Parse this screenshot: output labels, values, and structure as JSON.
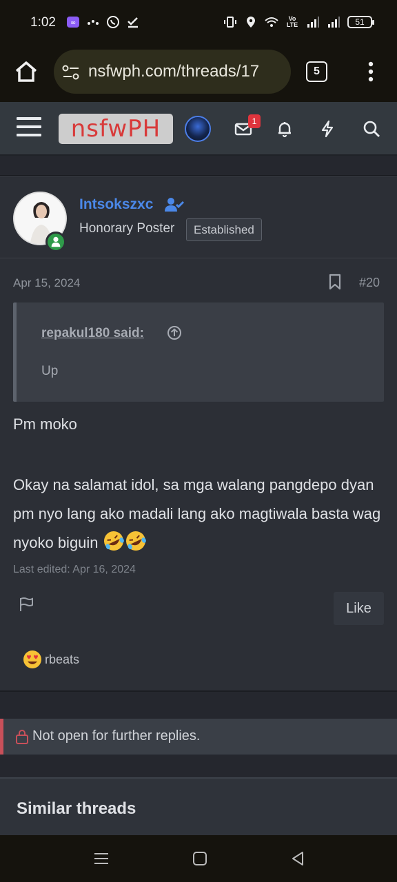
{
  "status_bar": {
    "time": "1:02",
    "battery": "51",
    "volte": "Vo LTE"
  },
  "browser": {
    "url": "nsfwph.com/threads/17",
    "tab_count": "5"
  },
  "site_header": {
    "logo": "nsfwPH",
    "inbox_badge": "1"
  },
  "post": {
    "username": "Intsokszxc",
    "user_title": "Honorary Poster",
    "user_badge": "Established",
    "date": "Apr 15, 2024",
    "post_number": "#20",
    "quote": {
      "author": "repakul180 said:",
      "text": "Up"
    },
    "body_line1": "Pm moko",
    "body_paragraph": "Okay na salamat idol, sa mga walang pangdepo dyan pm nyo lang ako madali lang ako magtiwala basta wag nyoko biguin",
    "last_edited": "Last edited: Apr 16, 2024",
    "like_label": "Like",
    "reaction_user": "rbeats"
  },
  "locked_notice": "Not open for further replies.",
  "similar_threads_title": "Similar threads",
  "colors": {
    "accent": "#4b88e8",
    "danger": "#e0343d",
    "online": "#2f9a4a"
  }
}
